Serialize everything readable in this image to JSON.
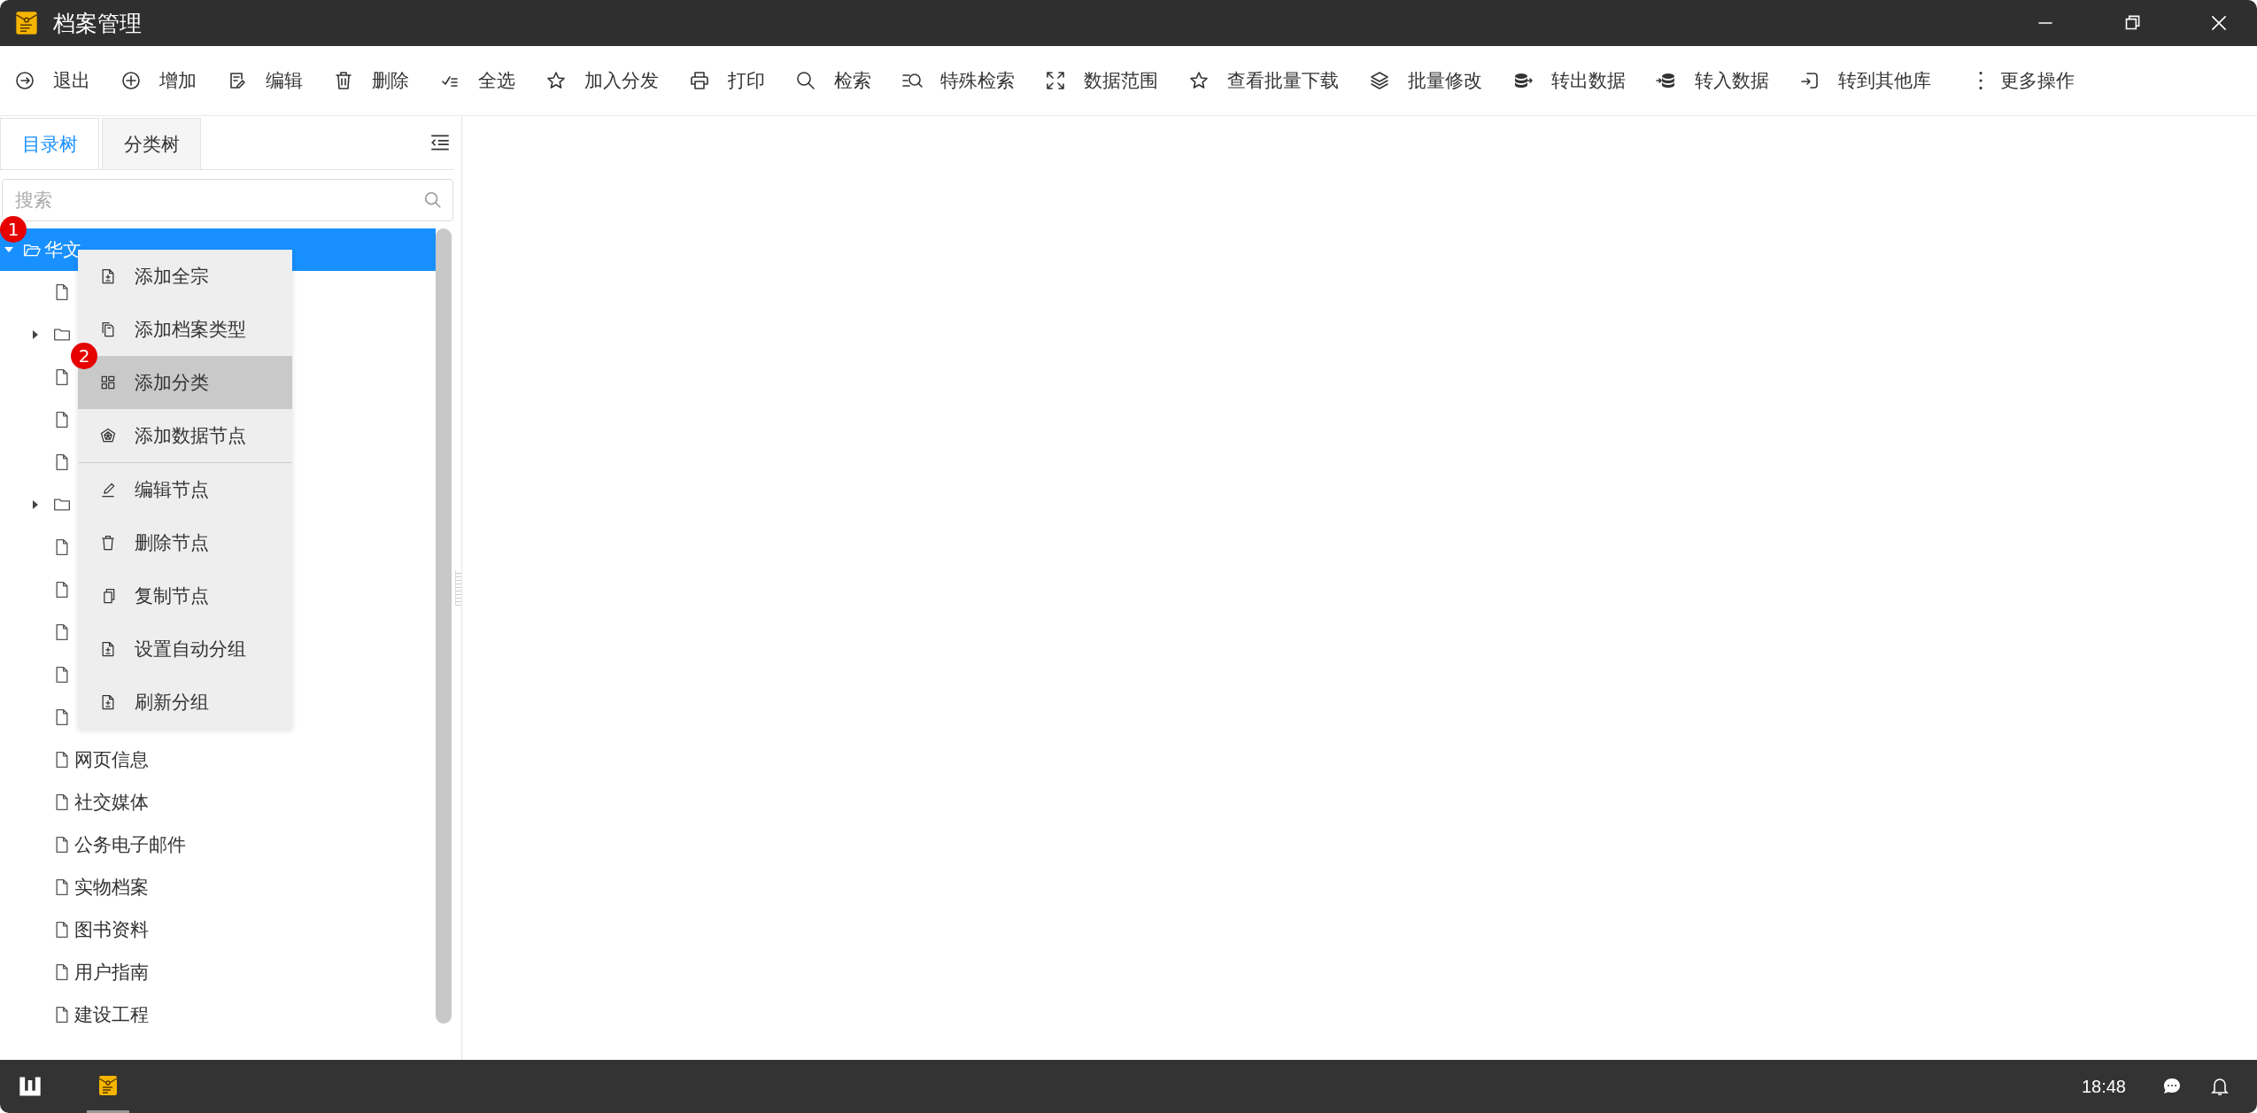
{
  "window": {
    "title": "档案管理"
  },
  "toolbar": [
    {
      "label": "退出"
    },
    {
      "label": "增加"
    },
    {
      "label": "编辑"
    },
    {
      "label": "删除"
    },
    {
      "label": "全选"
    },
    {
      "label": "加入分发"
    },
    {
      "label": "打印"
    },
    {
      "label": "检索"
    },
    {
      "label": "特殊检索"
    },
    {
      "label": "数据范围"
    },
    {
      "label": "查看批量下载"
    },
    {
      "label": "批量修改"
    },
    {
      "label": "转出数据"
    },
    {
      "label": "转入数据"
    },
    {
      "label": "转到其他库"
    },
    {
      "label": "更多操作"
    }
  ],
  "sidebar": {
    "tabs": [
      {
        "label": "目录树",
        "selected": true
      },
      {
        "label": "分类树",
        "selected": false
      }
    ],
    "search": {
      "placeholder": "搜索"
    },
    "tree": [
      {
        "label": "华文",
        "kind": "folder",
        "expanded": true,
        "selected": true,
        "badge": "1",
        "children": [
          {
            "kind": "file",
            "selected": false
          },
          {
            "kind": "folder",
            "expanded": false,
            "selected": false
          },
          {
            "kind": "file",
            "selected": false
          },
          {
            "kind": "file",
            "selected": false
          },
          {
            "kind": "file",
            "selected": false
          },
          {
            "kind": "folder",
            "expanded": false,
            "selected": false
          },
          {
            "kind": "file",
            "selected": false
          },
          {
            "kind": "file",
            "selected": false
          },
          {
            "kind": "file",
            "selected": false
          },
          {
            "kind": "file",
            "selected": false
          },
          {
            "kind": "file",
            "selected": false
          },
          {
            "label": "网页信息",
            "kind": "file",
            "selected": false
          },
          {
            "label": "社交媒体",
            "kind": "file",
            "selected": false
          },
          {
            "label": "公务电子邮件",
            "kind": "file",
            "selected": false
          },
          {
            "label": "实物档案",
            "kind": "file",
            "selected": false
          },
          {
            "label": "图书资料",
            "kind": "file",
            "selected": false
          },
          {
            "label": "用户指南",
            "kind": "file",
            "selected": false
          },
          {
            "label": "建设工程",
            "kind": "file",
            "selected": false
          }
        ]
      }
    ]
  },
  "context_menu": {
    "sections": [
      [
        {
          "label": "添加全宗",
          "selected": false
        },
        {
          "label": "添加档案类型",
          "selected": false
        },
        {
          "label": "添加分类",
          "selected": true,
          "badge": "2"
        },
        {
          "label": "添加数据节点",
          "selected": false
        }
      ],
      [
        {
          "label": "编辑节点",
          "selected": false
        },
        {
          "label": "删除节点",
          "selected": false
        },
        {
          "label": "复制节点",
          "selected": false
        },
        {
          "label": "设置自动分组",
          "selected": false
        },
        {
          "label": "刷新分组",
          "selected": false
        }
      ]
    ]
  },
  "taskbar": {
    "clock": "18:48"
  }
}
